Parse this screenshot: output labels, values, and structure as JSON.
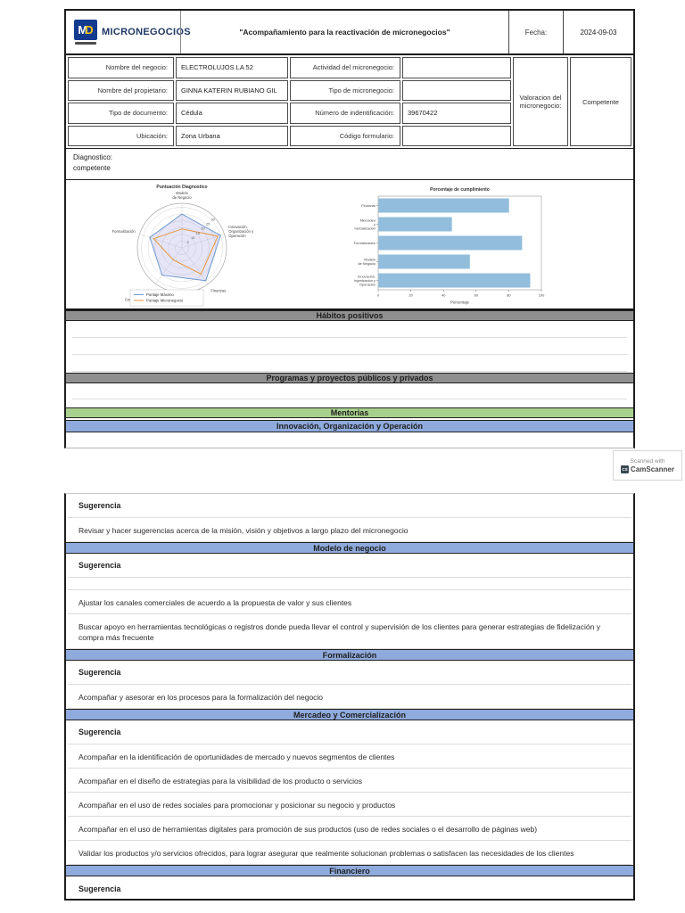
{
  "page1": {
    "logo": {
      "mark": "MD",
      "name": "MICRONEGOCIOS"
    },
    "title": "\"Acompañamiento para la reactivación de micronegocios\"",
    "fecha_label": "Fecha:",
    "fecha_value": "2024-09-03",
    "form": {
      "rows": [
        {
          "label": "Nombre del negocio:",
          "value": "ELECTROLUJOS LA 52",
          "label2": "Actividad del micronegocio:",
          "value2": ""
        },
        {
          "label": "Nombre del propietario:",
          "value": "GINNA KATERIN RUBIANO GIL",
          "label2": "Tipo de micronegocio:",
          "value2": ""
        },
        {
          "label": "Tipo de documento:",
          "value": "Cédula",
          "label2": "Número de indentificación:",
          "value2": "39670422"
        },
        {
          "label": "Ubicación:",
          "value": "Zona Urbana",
          "label2": "Código formulario:",
          "value2": ""
        }
      ],
      "valoracion_label": "Valoracion del micronegocio:",
      "valoracion_value": "Competente"
    },
    "diagnostico_label": "Diagnostico:",
    "diagnostico_value": "competente",
    "section_habitos": "Hábitos positivos",
    "section_programas": "Programas y proyectos públicos y privados",
    "section_mentorias": "Mentorias",
    "section_innovacion": "Innovación, Organización y Operación"
  },
  "camscanner": {
    "line1": "Scanned with",
    "icon": "CS",
    "brand": "CamScanner"
  },
  "page2": {
    "items": [
      {
        "type": "label",
        "text": "Sugerencia"
      },
      {
        "type": "text",
        "text": "Revisar y hacer sugerencias acerca de la misión, visión y objetivos a largo plazo del micronegocio"
      },
      {
        "type": "header",
        "text": "Modelo de negocio"
      },
      {
        "type": "label",
        "text": "Sugerencia"
      },
      {
        "type": "blank",
        "text": ""
      },
      {
        "type": "text",
        "text": "Ajustar los canales comerciales de acuerdo a la propuesta de valor y sus clientes"
      },
      {
        "type": "text2",
        "text": "Buscar apoyo en herramientas tecnológicas o registros donde pueda llevar el control y supervisión de los clientes para generar estrategias de fidelización y compra más frecuente"
      },
      {
        "type": "header",
        "text": "Formalización"
      },
      {
        "type": "label",
        "text": "Sugerencia"
      },
      {
        "type": "text",
        "text": "Acompañar y asesorar en los procesos para la formalización del negocio"
      },
      {
        "type": "header",
        "text": "Mercadeo y Comercialización"
      },
      {
        "type": "label",
        "text": "Sugerencia"
      },
      {
        "type": "text",
        "text": "Acompañar en la identificación de oportunidades de mercado y nuevos segmentos de clientes"
      },
      {
        "type": "text",
        "text": "Acompañar en el diseño de estrategias para la visibilidad de los producto o servicios"
      },
      {
        "type": "text",
        "text": "Acompañar en el uso de redes sociales para promocionar y posicionar su negocio y productos"
      },
      {
        "type": "text",
        "text": "Acompañar en el uso de herramientas digitales para promoción de sus productos (uso de redes sociales o el desarrollo de páginas web)"
      },
      {
        "type": "text",
        "text": "Validar los productos y/o servicios ofrecidos, para lograr asegurar que realmente solucionan problemas o satisfacen las necesidades de los clientes"
      },
      {
        "type": "header",
        "text": "Financiero"
      },
      {
        "type": "label",
        "text": "Sugerencia"
      }
    ]
  },
  "chart_data": [
    {
      "type": "radar",
      "title": "Puntuación Diagnostico",
      "categories": [
        "Modelo de Negocio",
        "Formalización",
        "Mercadeo y Comercialización",
        "Finanzas",
        "Innovación, Organización y Operación"
      ],
      "category_lines": [
        [
          "Modelo",
          "de Negocio"
        ],
        [
          "Formalización"
        ],
        [
          "Mercadeo",
          "y",
          "Comercialización"
        ],
        [
          "Finanzas"
        ],
        [
          "Innovación,",
          "Organización y",
          "Operación"
        ]
      ],
      "series": [
        {
          "name": "Puntaje Máximo",
          "color": "#6f9ad0",
          "fill": "rgba(150,150,225,0.25)",
          "values": [
            25,
            25,
            25,
            30,
            30
          ]
        },
        {
          "name": "Puntaje Micronegocio",
          "color": "#e8963b",
          "fill": "none",
          "values": [
            14,
            22,
            11,
            24,
            28
          ]
        }
      ],
      "rmax": 30,
      "ticks": [
        5,
        10,
        15,
        20,
        25,
        30
      ],
      "grid": true,
      "legend_position": "lower-left"
    },
    {
      "type": "bar",
      "orientation": "horizontal",
      "title": "Porcentaje de cumplimiento",
      "categories": [
        "Finanzas",
        "Mercadeo y comercialización",
        "Formalización",
        "Modelo de Negocio",
        "Innovación, Organización y Operación"
      ],
      "category_lines": [
        [
          "Finanzas"
        ],
        [
          "Mercadeo",
          "y",
          "comercialización"
        ],
        [
          "Formalización"
        ],
        [
          "Modelo",
          "de Negocio"
        ],
        [
          "Innovación,",
          "Organización y",
          "Operación"
        ]
      ],
      "values": [
        80,
        45,
        88,
        56,
        93
      ],
      "xlabel": "Porcentaje",
      "ylabel": "",
      "xlim": [
        0,
        100
      ],
      "xticks": [
        0,
        20,
        40,
        60,
        80,
        100
      ],
      "bar_color": "#92bddc",
      "grid": false
    }
  ]
}
